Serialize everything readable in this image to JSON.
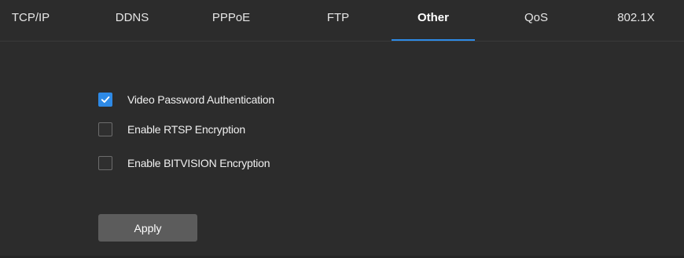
{
  "tabs": [
    {
      "label": "TCP/IP",
      "active": false
    },
    {
      "label": "DDNS",
      "active": false
    },
    {
      "label": "PPPoE",
      "active": false
    },
    {
      "label": "FTP",
      "active": false
    },
    {
      "label": "Other",
      "active": true
    },
    {
      "label": "QoS",
      "active": false
    },
    {
      "label": "802.1X",
      "active": false
    }
  ],
  "options": [
    {
      "label": "Video Password Authentication",
      "checked": true
    },
    {
      "label": "Enable RTSP Encryption",
      "checked": false
    },
    {
      "label": "Enable BITVISION Encryption",
      "checked": false
    }
  ],
  "apply_label": "Apply",
  "colors": {
    "accent": "#2e8ae6",
    "background": "#2c2c2c",
    "button": "#5c5c5c"
  }
}
